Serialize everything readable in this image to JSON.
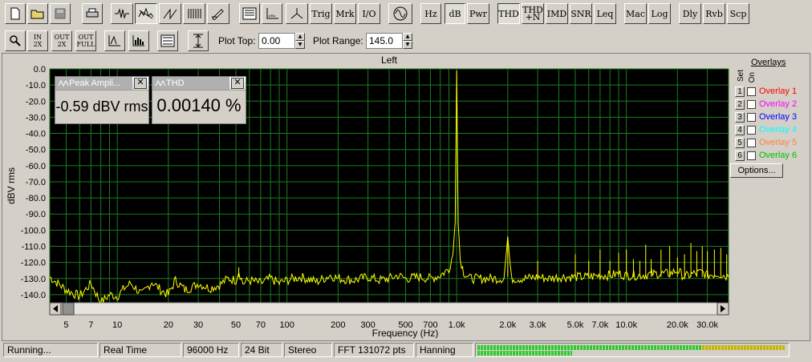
{
  "toolbar1": {
    "text_buttons": {
      "trig": "Trig",
      "mrk": "Mrk",
      "io": "I/O",
      "hz": "Hz",
      "db": "dB",
      "pwr": "Pwr",
      "thd": "THD",
      "thdn_a": "THD",
      "thdn_b": "+N",
      "imd": "IMD",
      "snr": "SNR",
      "leq": "Leq",
      "mac": "Mac",
      "log": "Log",
      "dly": "Dly",
      "rvb": "Rvb",
      "scp": "Scp"
    }
  },
  "toolbar2": {
    "btn_in2x_a": "IN",
    "btn_in2x_b": "2X",
    "btn_out2x_a": "OUT",
    "btn_out2x_b": "2X",
    "btn_outfull_a": "OUT",
    "btn_outfull_b": "FULL",
    "plot_top_label": "Plot Top:",
    "plot_top_value": "0.00",
    "plot_range_label": "Plot Range:",
    "plot_range_value": "145.0"
  },
  "chart_title": "Left",
  "readouts": {
    "peak_title": "Peak Ampli...",
    "peak_value": "-0.59 dBV rms",
    "thd_title": "THD",
    "thd_value": "0.00140 %"
  },
  "overlays": {
    "header_set": "Set",
    "header_on": "On",
    "title": "Overlays",
    "items": [
      {
        "num": "1",
        "label": "Overlay 1",
        "color": "#ff0000"
      },
      {
        "num": "2",
        "label": "Overlay 2",
        "color": "#ff00ff"
      },
      {
        "num": "3",
        "label": "Overlay 3",
        "color": "#0000ff"
      },
      {
        "num": "4",
        "label": "Overlay 4",
        "color": "#00ffff"
      },
      {
        "num": "5",
        "label": "Overlay 5",
        "color": "#ff8040"
      },
      {
        "num": "6",
        "label": "Overlay 6",
        "color": "#00c000"
      }
    ],
    "options_label": "Options..."
  },
  "status": {
    "state": "Running...",
    "mode": "Real Time",
    "rate": "96000 Hz",
    "bits": "24 Bit",
    "channels": "Stereo",
    "fft": "FFT 131072 pts",
    "window": "Hanning"
  },
  "chart_data": {
    "type": "line",
    "title": "Left",
    "xlabel": "Frequency (Hz)",
    "ylabel": "dBV rms",
    "x_scale": "log",
    "xlim": [
      4,
      40000
    ],
    "ylim": [
      -145,
      0
    ],
    "grid": true,
    "y_ticks": [
      "0.0",
      "-10.0",
      "-20.0",
      "-30.0",
      "-40.0",
      "-50.0",
      "-60.0",
      "-70.0",
      "-80.0",
      "-90.0",
      "-100.0",
      "-110.0",
      "-120.0",
      "-130.0",
      "-140.0"
    ],
    "y_tick_values": [
      0,
      -10,
      -20,
      -30,
      -40,
      -50,
      -60,
      -70,
      -80,
      -90,
      -100,
      -110,
      -120,
      -130,
      -140
    ],
    "x_ticks": [
      {
        "v": 5,
        "label": "5"
      },
      {
        "v": 7,
        "label": "7"
      },
      {
        "v": 10,
        "label": "10"
      },
      {
        "v": 20,
        "label": "20"
      },
      {
        "v": 30,
        "label": "30"
      },
      {
        "v": 50,
        "label": "50"
      },
      {
        "v": 70,
        "label": "70"
      },
      {
        "v": 100,
        "label": "100"
      },
      {
        "v": 200,
        "label": "200"
      },
      {
        "v": 300,
        "label": "300"
      },
      {
        "v": 500,
        "label": "500"
      },
      {
        "v": 700,
        "label": "700"
      },
      {
        "v": 1000,
        "label": "1.0k"
      },
      {
        "v": 2000,
        "label": "2.0k"
      },
      {
        "v": 3000,
        "label": "3.0k"
      },
      {
        "v": 5000,
        "label": "5.0k"
      },
      {
        "v": 7000,
        "label": "7.0k"
      },
      {
        "v": 10000,
        "label": "10.0k"
      },
      {
        "v": 20000,
        "label": "20.0k"
      },
      {
        "v": 30000,
        "label": "30.0k"
      }
    ],
    "series": [
      {
        "color": "#ffff00",
        "points": [
          [
            4,
            -129
          ],
          [
            5,
            -137
          ],
          [
            6,
            -141
          ],
          [
            7,
            -133
          ],
          [
            8,
            -145
          ],
          [
            9,
            -140
          ],
          [
            10,
            -141
          ],
          [
            11,
            -136
          ],
          [
            12,
            -133
          ],
          [
            14,
            -140
          ],
          [
            16,
            -132
          ],
          [
            18,
            -137
          ],
          [
            20,
            -140
          ],
          [
            22,
            -131
          ],
          [
            25,
            -137
          ],
          [
            28,
            -135
          ],
          [
            30,
            -133
          ],
          [
            35,
            -136
          ],
          [
            40,
            -134
          ],
          [
            45,
            -130
          ],
          [
            50,
            -131
          ],
          [
            52,
            -125
          ],
          [
            55,
            -133
          ],
          [
            60,
            -131
          ],
          [
            70,
            -133
          ],
          [
            80,
            -130
          ],
          [
            90,
            -133
          ],
          [
            100,
            -131
          ],
          [
            120,
            -129
          ],
          [
            150,
            -132
          ],
          [
            180,
            -128
          ],
          [
            200,
            -130
          ],
          [
            250,
            -131
          ],
          [
            300,
            -129
          ],
          [
            350,
            -131
          ],
          [
            400,
            -130
          ],
          [
            450,
            -128
          ],
          [
            500,
            -130
          ],
          [
            600,
            -129
          ],
          [
            700,
            -130
          ],
          [
            800,
            -128
          ],
          [
            900,
            -124
          ],
          [
            950,
            -115
          ],
          [
            980,
            -95
          ],
          [
            1000,
            -1
          ],
          [
            1020,
            -95
          ],
          [
            1050,
            -118
          ],
          [
            1100,
            -126
          ],
          [
            1200,
            -130
          ],
          [
            1500,
            -130
          ],
          [
            1900,
            -130
          ],
          [
            2000,
            -104
          ],
          [
            2100,
            -130
          ],
          [
            2500,
            -130
          ],
          [
            3000,
            -129
          ],
          [
            3500,
            -130
          ],
          [
            4000,
            -129
          ],
          [
            5000,
            -129
          ],
          [
            6000,
            -129
          ],
          [
            7000,
            -128
          ],
          [
            8000,
            -128
          ],
          [
            9000,
            -127
          ],
          [
            10000,
            -128
          ],
          [
            12000,
            -128
          ],
          [
            15000,
            -127
          ],
          [
            18000,
            -127
          ],
          [
            20000,
            -125
          ],
          [
            22000,
            -129
          ],
          [
            25000,
            -127
          ],
          [
            28000,
            -126
          ],
          [
            30000,
            -128
          ],
          [
            35000,
            -127
          ],
          [
            40000,
            -129
          ]
        ]
      }
    ],
    "spurs": [
      [
        52,
        -123
      ],
      [
        2000,
        -104
      ],
      [
        3000,
        -119
      ],
      [
        5000,
        -115
      ],
      [
        6000,
        -119
      ],
      [
        7000,
        -112
      ],
      [
        8000,
        -119
      ],
      [
        9000,
        -114
      ],
      [
        10000,
        -112
      ],
      [
        11000,
        -118
      ],
      [
        12000,
        -119
      ],
      [
        13000,
        -109
      ],
      [
        14000,
        -118
      ],
      [
        16000,
        -112
      ],
      [
        18000,
        -110
      ],
      [
        20000,
        -117
      ],
      [
        22000,
        -115
      ],
      [
        24000,
        -108
      ],
      [
        26000,
        -113
      ],
      [
        28000,
        -110
      ],
      [
        30000,
        -113
      ],
      [
        33000,
        -112
      ],
      [
        36000,
        -111
      ],
      [
        39000,
        -115
      ]
    ]
  }
}
